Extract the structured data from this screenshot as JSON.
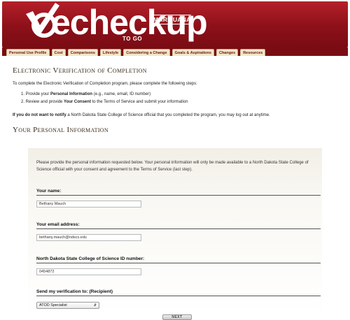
{
  "brand": {
    "logo_main": "echeckup",
    "logo_sub": "TO GO",
    "logo_tag": "MARIJUANA"
  },
  "tabs": [
    "Personal Use Profile",
    "Cost",
    "Comparisons",
    "Lifestyle",
    "Considering a Change",
    "Goals & Aspirations",
    "Changes",
    "Resources"
  ],
  "section1": {
    "title": "Electronic Verification of Completion",
    "intro": "To complete the Electronic Verification of Completion program, please complete the following steps:",
    "step1_pre": "1. Provide your ",
    "step1_bold": "Personal Information",
    "step1_post": " (e.g., name, email, ID number)",
    "step2_pre": "2. Review and provide ",
    "step2_bold": "Your Consent",
    "step2_post": " to the Terms of Service and submit your information",
    "notify_bold": "If you do not want to notify",
    "notify_rest": " a North Dakota State College of Science official that you completed the program, you may log out at anytime."
  },
  "section2": {
    "title": "Your Personal Information",
    "description": "Please provide the personal information requested below. Your personal information will only be made available to a North Dakota State College of Science official with your consent and agreement to the Terms of Service (last step).",
    "name_label": "Your name:",
    "name_value": "Bethany Mauch",
    "email_label": "Your email address:",
    "email_value": "bethany.mauch@ndscs.edu",
    "id_label": "North Dakota State College of Science ID number:",
    "id_value": "0454872",
    "recipient_label": "Send my verification to: (Recipient)",
    "recipient_value": "ATOD Specialist"
  },
  "buttons": {
    "next": "NEXT"
  }
}
